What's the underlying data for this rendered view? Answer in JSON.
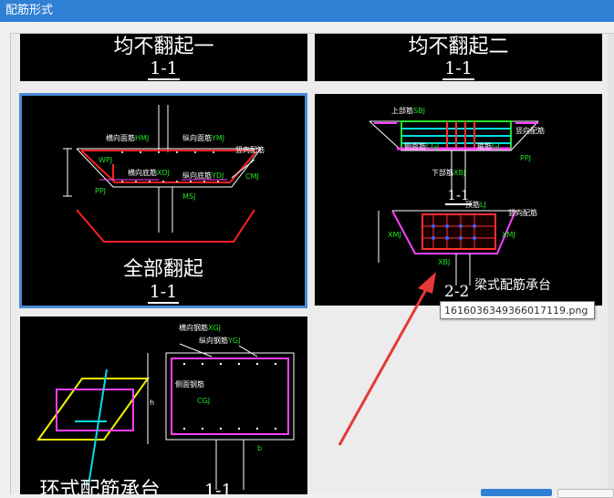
{
  "window": {
    "title": "配筋形式"
  },
  "options": [
    {
      "caption": "均不翻起一",
      "section": "1-1"
    },
    {
      "caption": "均不翻起二",
      "section": "1-1"
    },
    {
      "caption": "全部翻起",
      "section": "1-1",
      "labels": {
        "transverse_top": "横向面筋",
        "transverse_top_code": "HMJ",
        "longitudinal_top": "纵向面筋",
        "longitudinal_top_code": "YMJ",
        "transverse_bottom": "横向底筋",
        "transverse_bottom_code": "XDJ",
        "longitudinal_bottom": "纵向底筋",
        "longitudinal_bottom_code": "YDJ",
        "anchor_code": "CMJ",
        "side_code": "PPJ",
        "hook_code": "WPJ",
        "wall_code": "MSJ",
        "slope": "竖向配筋"
      }
    },
    {
      "caption": "梁式配筋承台",
      "section_top": "1-1",
      "section_bottom": "2-2",
      "labels": {
        "top_bar": "上部筋",
        "top_bar_code": "SBJ",
        "stirrup": "箍筋",
        "stirrup_code": "GJ",
        "side_bar": "侧面筋",
        "side_bar_code": "CGJ",
        "bottom_bar": "下部筋",
        "bottom_bar_code": "XBJ",
        "top_bar2": "顶筋",
        "top_bar2_code": "LJ",
        "slope": "竖向配筋",
        "code_ppj": "PPJ",
        "code_xmj": "XMJ",
        "code_xmj2": "XMJ",
        "code_xbj": "XBJ"
      }
    },
    {
      "caption": "环式配筋承台",
      "section": "1-1",
      "labels": {
        "transverse": "横向钢筋",
        "transverse_code": "XGJ",
        "longitudinal": "纵向钢筋",
        "longitudinal_code": "YGJ",
        "side": "侧面钢筋",
        "side_code": "CGJ",
        "dim": "h",
        "dim2": "b"
      }
    }
  ],
  "tooltip": {
    "text": "1616036349366017119.png"
  },
  "colors": {
    "accent": "#2f7fd4",
    "selection": "#4a8ad6",
    "arrow": "#e53935"
  }
}
